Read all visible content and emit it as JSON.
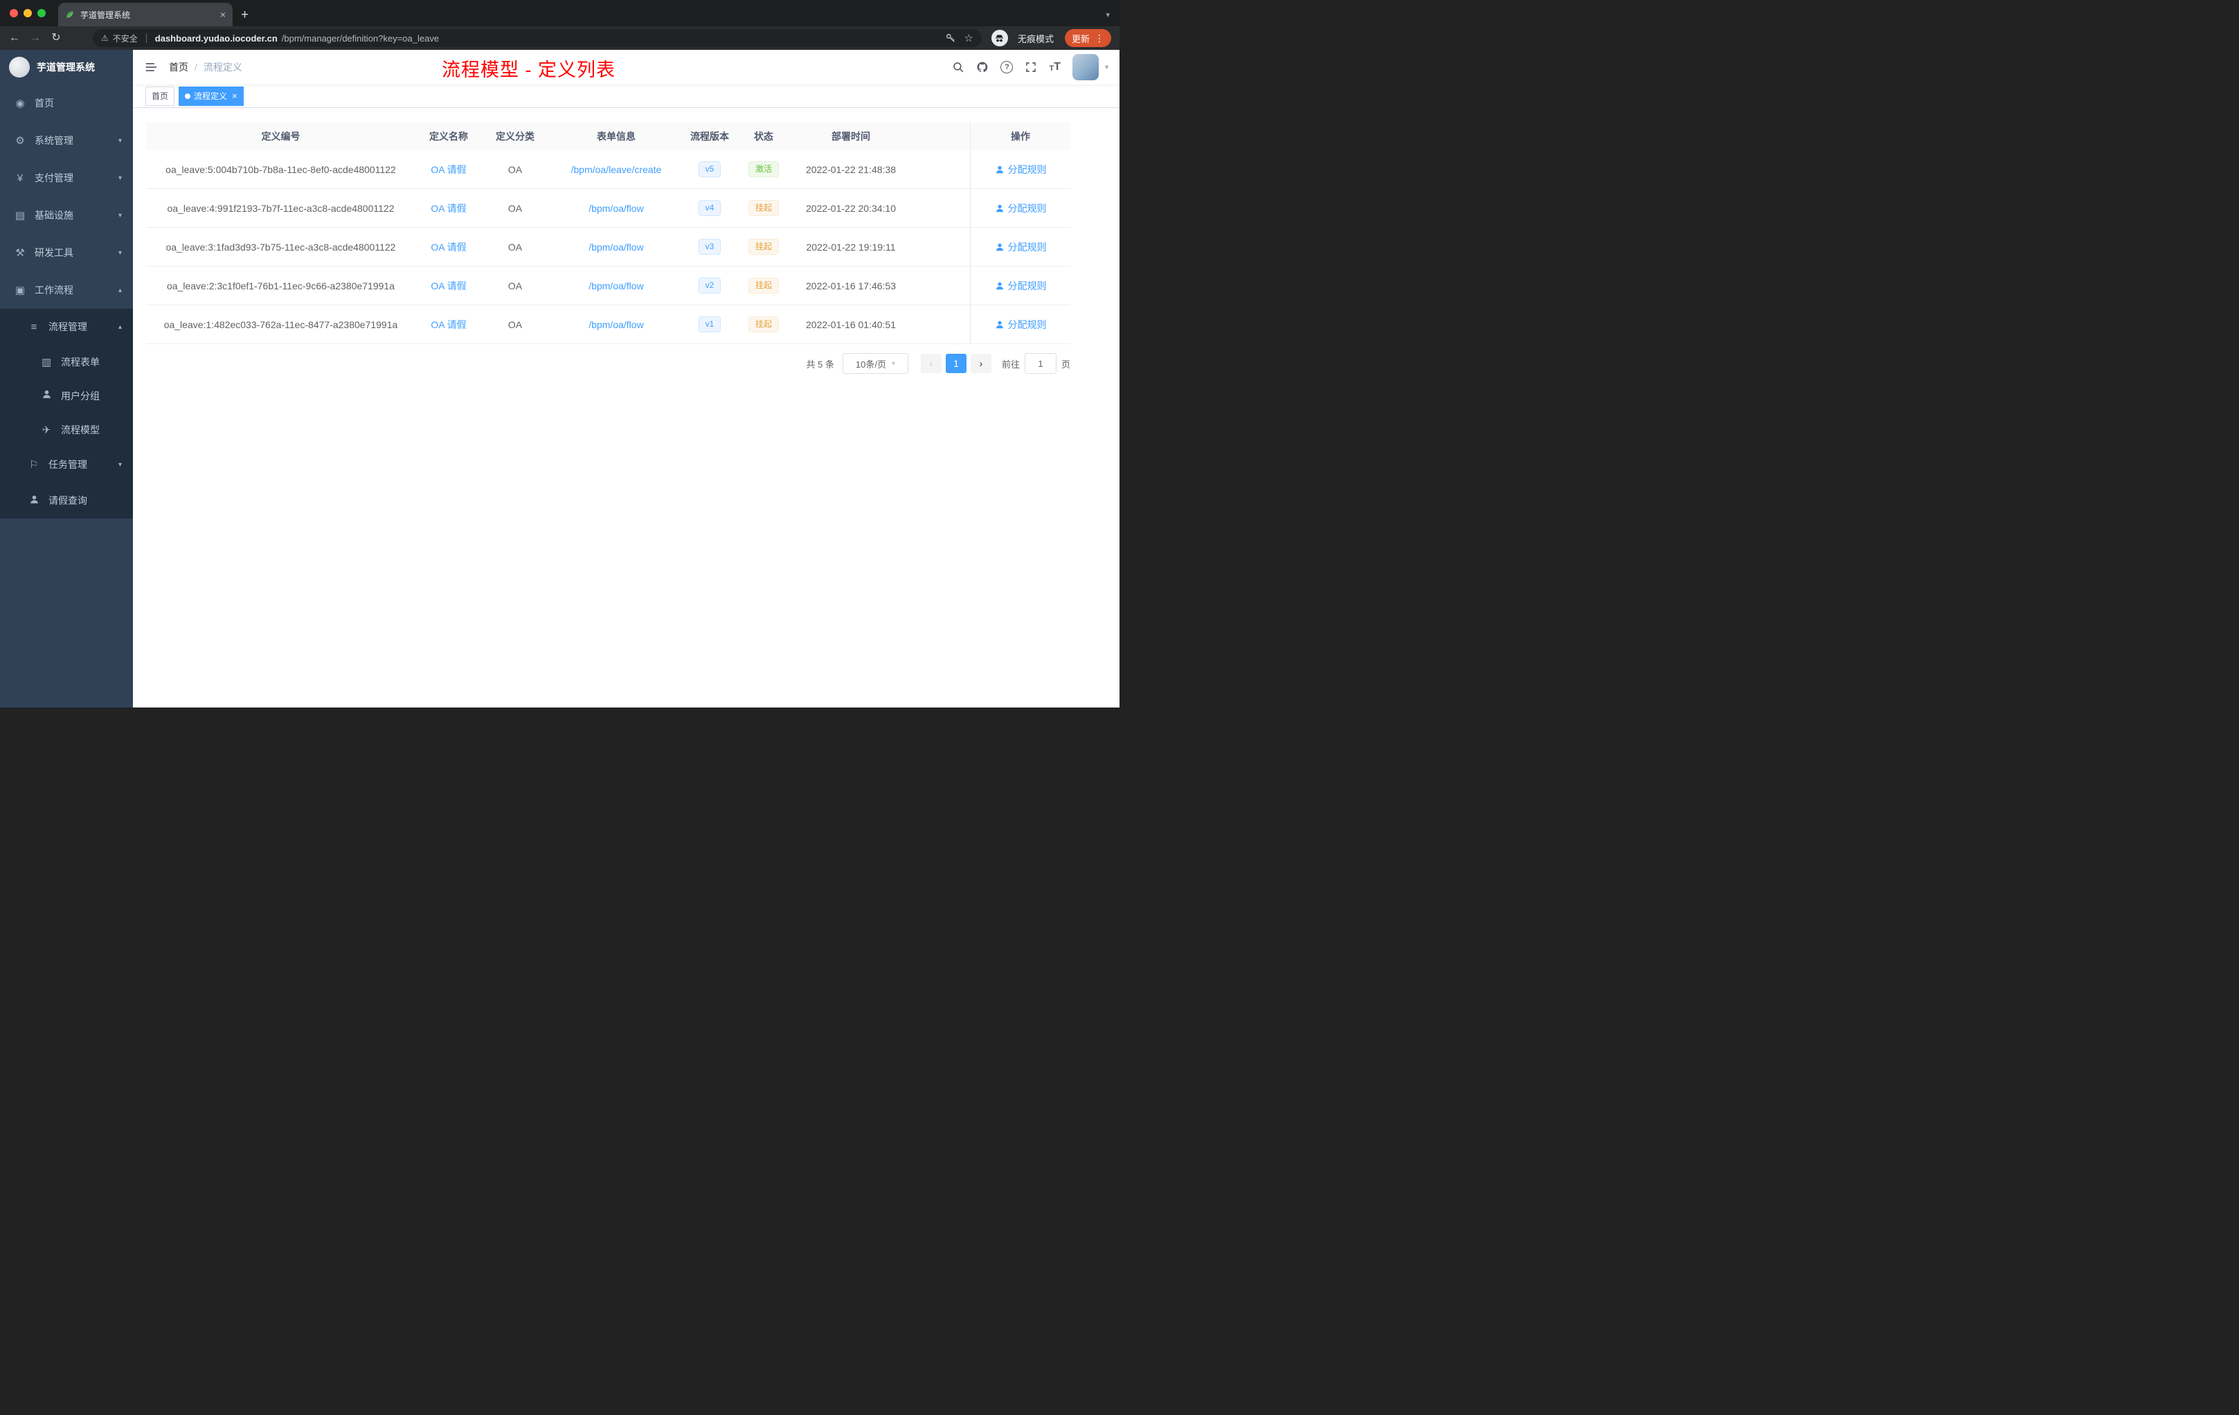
{
  "colors": {
    "accent": "#409eff",
    "success": "#67c23a",
    "warning": "#e6a23c",
    "title_red": "#ff0000",
    "sidebar_bg": "#304156",
    "submenu_bg": "#1f2d3d",
    "update_pill": "#d9532f"
  },
  "icons": {
    "back": "←",
    "forward": "→",
    "reload": "↻",
    "warning": "⚠",
    "star": "☆",
    "menu_dots": "⋮",
    "new_tab": "+",
    "close": "×",
    "caret_down": "▾",
    "caret_up": "▴",
    "prev": "‹",
    "next": "›",
    "question": "?",
    "font_letter": "T"
  },
  "browser": {
    "tab_title": "芋道管理系统",
    "security_label": "不安全",
    "url_domain": "dashboard.yudao.iocoder.cn",
    "url_path": "/bpm/manager/definition?key=oa_leave",
    "incognito_label": "无痕模式",
    "update_label": "更新"
  },
  "sidebar": {
    "logo_title": "芋道管理系统",
    "items": [
      {
        "label": "首页",
        "icon": "◉"
      },
      {
        "label": "系统管理",
        "icon": "⚙"
      },
      {
        "label": "支付管理",
        "icon": "¥"
      },
      {
        "label": "基础设施",
        "icon": "▤"
      },
      {
        "label": "研发工具",
        "icon": "⚒"
      },
      {
        "label": "工作流程",
        "icon": "▣"
      },
      {
        "label": "流程管理",
        "icon": "≡"
      },
      {
        "label": "流程表单",
        "icon": "▥"
      },
      {
        "label": "用户分组",
        "icon": "person"
      },
      {
        "label": "流程模型",
        "icon": "✈"
      },
      {
        "label": "任务管理",
        "icon": "⚐"
      },
      {
        "label": "请假查询",
        "icon": "person"
      }
    ]
  },
  "navbar": {
    "breadcrumb_home": "首页",
    "breadcrumb_current": "流程定义",
    "page_title": "流程模型 - 定义列表"
  },
  "tags": {
    "home": "首页",
    "current": "流程定义"
  },
  "table": {
    "headers": [
      "定义编号",
      "定义名称",
      "定义分类",
      "表单信息",
      "流程版本",
      "状态",
      "部署时间",
      "操作"
    ],
    "rows": [
      {
        "id": "oa_leave:5:004b710b-7b8a-11ec-8ef0-acde48001122",
        "name": "OA 请假",
        "category": "OA",
        "form": "/bpm/oa/leave/create",
        "version": "v5",
        "status": "激活",
        "time": "2022-01-22 21:48:38",
        "action": "分配规则"
      },
      {
        "id": "oa_leave:4:991f2193-7b7f-11ec-a3c8-acde48001122",
        "name": "OA 请假",
        "category": "OA",
        "form": "/bpm/oa/flow",
        "version": "v4",
        "status": "挂起",
        "time": "2022-01-22 20:34:10",
        "action": "分配规则"
      },
      {
        "id": "oa_leave:3:1fad3d93-7b75-11ec-a3c8-acde48001122",
        "name": "OA 请假",
        "category": "OA",
        "form": "/bpm/oa/flow",
        "version": "v3",
        "status": "挂起",
        "time": "2022-01-22 19:19:11",
        "action": "分配规则"
      },
      {
        "id": "oa_leave:2:3c1f0ef1-76b1-11ec-9c66-a2380e71991a",
        "name": "OA 请假",
        "category": "OA",
        "form": "/bpm/oa/flow",
        "version": "v2",
        "status": "挂起",
        "time": "2022-01-16 17:46:53",
        "action": "分配规则"
      },
      {
        "id": "oa_leave:1:482ec033-762a-11ec-8477-a2380e71991a",
        "name": "OA 请假",
        "category": "OA",
        "form": "/bpm/oa/flow",
        "version": "v1",
        "status": "挂起",
        "time": "2022-01-16 01:40:51",
        "action": "分配规则"
      }
    ]
  },
  "pagination": {
    "total": "共 5 条",
    "page_size": "10条/页",
    "current_page": "1",
    "goto_label": "前往",
    "goto_value": "1",
    "page_unit": "页"
  }
}
